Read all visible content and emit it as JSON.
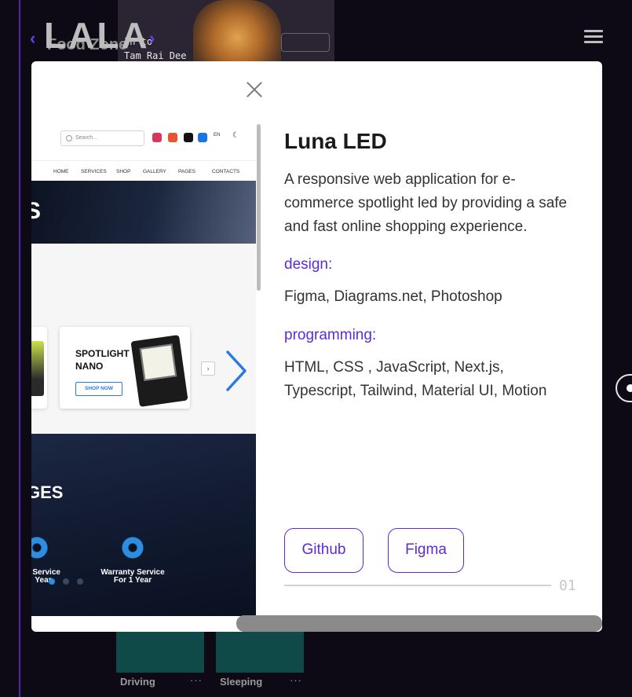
{
  "site": {
    "logo": "LALA",
    "bg_subtitle": "Food Zone",
    "bg_card_line1": "In to",
    "bg_card_line2": "Tam Rai Dee",
    "bg_tiles": [
      {
        "label": "Driving",
        "dots": "···"
      },
      {
        "label": "Sleeping",
        "dots": "···"
      }
    ]
  },
  "modal": {
    "title": "Luna LED",
    "description": "A responsive web application for e-commerce spotlight led by providing a safe and fast online shopping experience.",
    "sections": [
      {
        "label": "design:",
        "value": "Figma, Diagrams.net, Photoshop"
      },
      {
        "label": "programming:",
        "value": "HTML, CSS , JavaScript, Next.js, Typescript, Tailwind, Material UI, Motion"
      }
    ],
    "links": [
      {
        "label": "Github"
      },
      {
        "label": "Figma"
      }
    ],
    "page_number": "01"
  },
  "preview": {
    "search_placeholder": "Search...",
    "lang": "EN",
    "nav": [
      "HOME",
      "SERVICES",
      "SHOP",
      "GALLERY",
      "PAGES",
      "CONTACTS"
    ],
    "hero_text": "S",
    "card_title": "SPOTLIGHT NANO",
    "card_button": "SHOP NOW",
    "bottom_text": "GES",
    "services": [
      {
        "label": "y Service Year"
      },
      {
        "label": "Warranty Service For 1 Year"
      }
    ]
  },
  "colors": {
    "accent": "#5b2bd6",
    "background": "#0d0a16",
    "preview_blue": "#2a7ae2"
  }
}
